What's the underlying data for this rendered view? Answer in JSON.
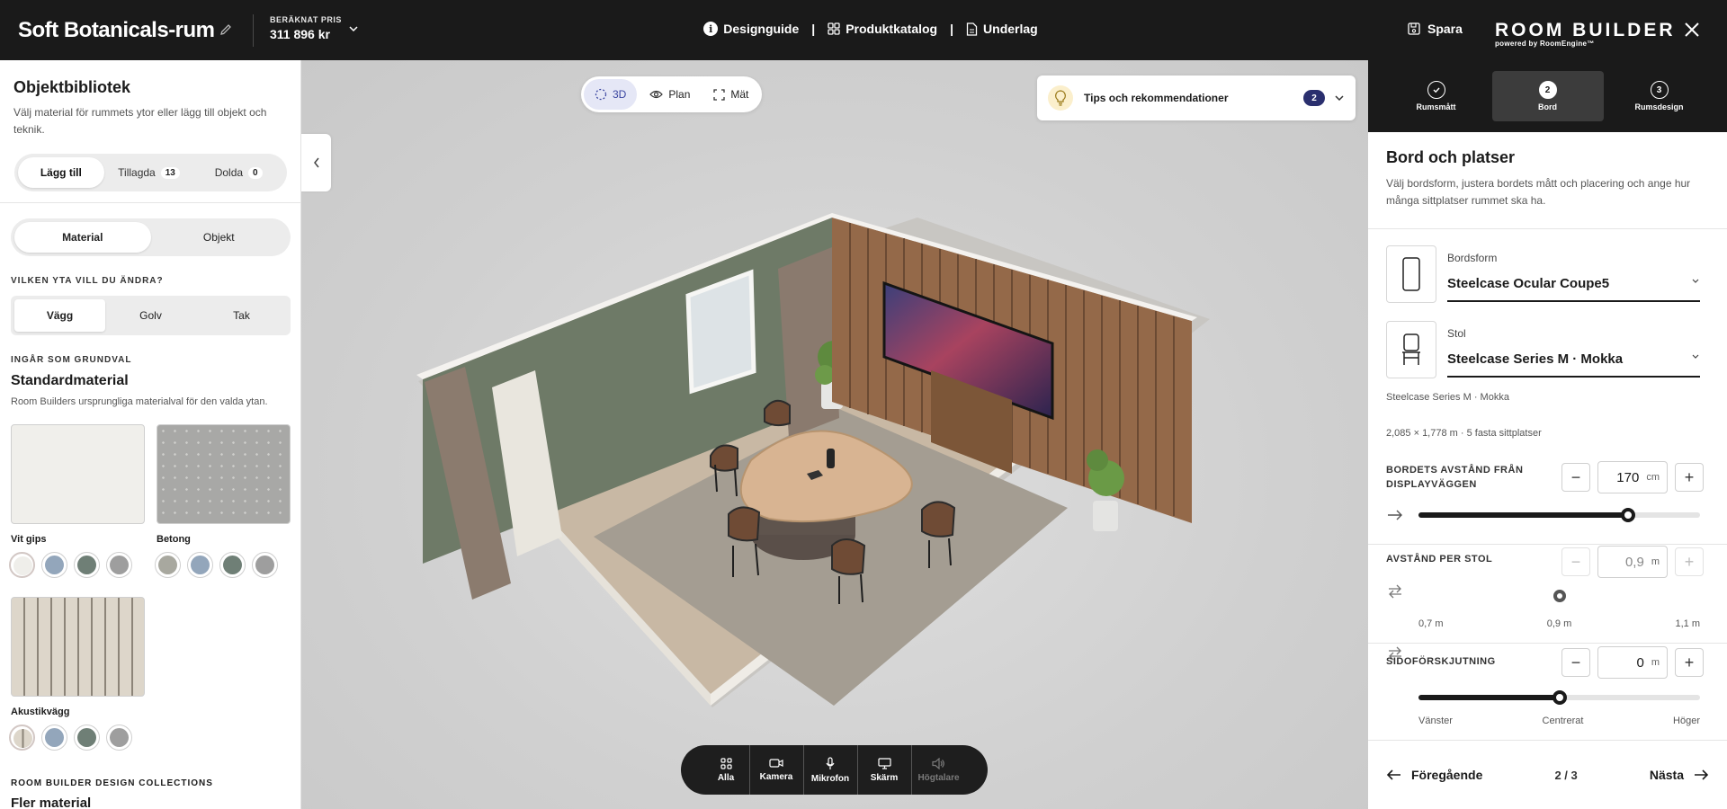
{
  "header": {
    "room_name": "Soft Botanicals-rum",
    "price_label": "BERÄKNAT PRIS",
    "price_value": "311 896 kr",
    "nav": [
      "Designguide",
      "Produktkatalog",
      "Underlag"
    ],
    "save_label": "Spara",
    "brand_name": "ROOM BUILDER",
    "brand_sub": "powered by RoomEngine™"
  },
  "library": {
    "title": "Objektbibliotek",
    "subtitle": "Välj material för rummets ytor eller lägg till objekt och teknik.",
    "tabs": [
      {
        "label": "Lägg till",
        "count": ""
      },
      {
        "label": "Tillagda",
        "count": "13"
      },
      {
        "label": "Dolda",
        "count": "0"
      }
    ],
    "mode_tabs": [
      "Material",
      "Objekt"
    ],
    "surface_question": "VILKEN YTA VILL DU ÄNDRA?",
    "surface_tabs": [
      "Vägg",
      "Golv",
      "Tak"
    ],
    "default_caption": "INGÅR SOM GRUNDVAL",
    "default_title": "Standardmaterial",
    "default_sub": "Room Builders ursprungliga materialval för den valda ytan.",
    "materials": [
      {
        "name": "Vit gips",
        "colors": [
          "#efeeea",
          "#93a6bb",
          "#6f7f76",
          "#9e9e9e"
        ]
      },
      {
        "name": "Betong",
        "colors": [
          "#a8a89f",
          "#93a6bb",
          "#6f7f76",
          "#9e9e9e"
        ]
      },
      {
        "name": "Akustikvägg",
        "colors": [
          "#d8d2c6",
          "#93a6bb",
          "#6f7f76",
          "#9e9e9e"
        ]
      }
    ],
    "collections_caption": "ROOM BUILDER DESIGN COLLECTIONS",
    "collections_title": "Fler material"
  },
  "viewport": {
    "view_modes": [
      "3D",
      "Plan",
      "Mät"
    ],
    "tips_label": "Tips och rekommendationer",
    "tips_count": "2",
    "dock": [
      "Alla",
      "Kamera",
      "Mikrofon",
      "Skärm",
      "Högtalare"
    ]
  },
  "wizard": {
    "steps": [
      {
        "num": "",
        "label": "Rumsmått"
      },
      {
        "num": "2",
        "label": "Bord"
      },
      {
        "num": "3",
        "label": "Rumsdesign"
      }
    ],
    "title": "Bord och platser",
    "subtitle": "Välj bordsform, justera bordets mått och placering och ange hur många sittplatser rummet ska ha.",
    "table_shape_label": "Bordsform",
    "table_shape_value": "Steelcase Ocular Coupe5",
    "chair_label": "Stol",
    "chair_value": "Steelcase Series M · Mokka",
    "chair_note": "Steelcase Series M · Mokka",
    "dims_note": "2,085 × 1,778 m · 5 fasta sittplatser",
    "distance": {
      "label": "BORDETS AVSTÅND FRÅN DISPLAYVÄGGEN",
      "value": "170",
      "unit": "cm",
      "fraction": 0.745
    },
    "chair_spacing": {
      "label": "AVSTÅND PER STOL",
      "value": "0,9",
      "unit": "m",
      "ticks": [
        "0,7 m",
        "0,9 m",
        "1,1 m"
      ],
      "fraction": 0.5
    },
    "offset": {
      "label": "SIDOFÖRSKJUTNING",
      "value": "0",
      "unit": "m",
      "ticks": [
        "Vänster",
        "Centrerat",
        "Höger"
      ],
      "fraction": 0.5
    },
    "prev_label": "Föregående",
    "page": "2 / 3",
    "next_label": "Nästa"
  }
}
